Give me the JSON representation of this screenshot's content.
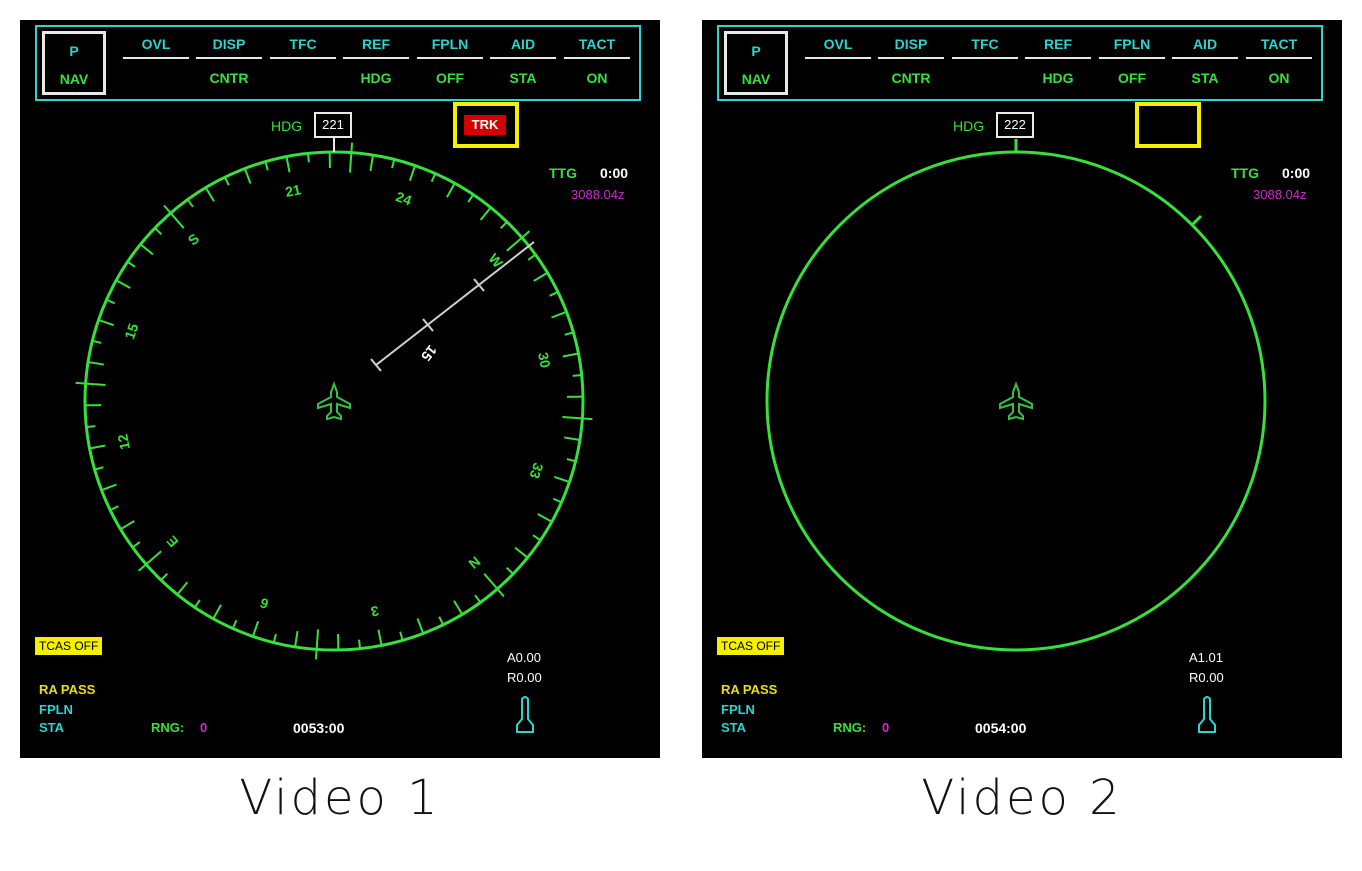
{
  "panels": [
    {
      "caption": "Video 1",
      "pnav": {
        "top": "P",
        "bottom": "NAV"
      },
      "menu": [
        {
          "top": "OVL",
          "bottom": ""
        },
        {
          "top": "DISP",
          "bottom": "CNTR"
        },
        {
          "top": "TFC",
          "bottom": ""
        },
        {
          "top": "REF",
          "bottom": "HDG"
        },
        {
          "top": "FPLN",
          "bottom": "OFF"
        },
        {
          "top": "AID",
          "bottom": "STA"
        },
        {
          "top": "TACT",
          "bottom": "ON"
        }
      ],
      "hdg_label": "HDG",
      "hdg_value": "221",
      "trk_badge": "TRK",
      "ttg_label": "TTG",
      "ttg_value": "0:00",
      "time_z": "3088.04z",
      "tcas": "TCAS OFF",
      "ra_pass": "RA PASS",
      "fpln": "FPLN",
      "sta": "STA",
      "rng_label": "RNG:",
      "rng_value": "0",
      "clock": "0053:00",
      "a_value": "A0.00",
      "r_value": "R0.00",
      "compass_labels": [
        "21",
        "24",
        "W",
        "30",
        "33",
        "N",
        "3",
        "6",
        "E",
        "12",
        "15",
        "S"
      ],
      "bearing_label": "15"
    },
    {
      "caption": "Video 2",
      "pnav": {
        "top": "P",
        "bottom": "NAV"
      },
      "menu": [
        {
          "top": "OVL",
          "bottom": ""
        },
        {
          "top": "DISP",
          "bottom": "CNTR"
        },
        {
          "top": "TFC",
          "bottom": ""
        },
        {
          "top": "REF",
          "bottom": "HDG"
        },
        {
          "top": "FPLN",
          "bottom": "OFF"
        },
        {
          "top": "AID",
          "bottom": "STA"
        },
        {
          "top": "TACT",
          "bottom": "ON"
        }
      ],
      "hdg_label": "HDG",
      "hdg_value": "222",
      "ttg_label": "TTG",
      "ttg_value": "0:00",
      "time_z": "3088.04z",
      "tcas": "TCAS OFF",
      "ra_pass": "RA PASS",
      "fpln": "FPLN",
      "sta": "STA",
      "rng_label": "RNG:",
      "rng_value": "0",
      "clock": "0054:00",
      "a_value": "A1.01",
      "r_value": "R0.00"
    }
  ],
  "colors": {
    "background": "#000000",
    "green": "#37e03a",
    "cyan": "#2ad4cf",
    "magenta": "#d02ad0",
    "yellow": "#f4f000",
    "alert_red": "#d40000"
  },
  "icons": [
    "aircraft-icon",
    "joystick-icon"
  ]
}
